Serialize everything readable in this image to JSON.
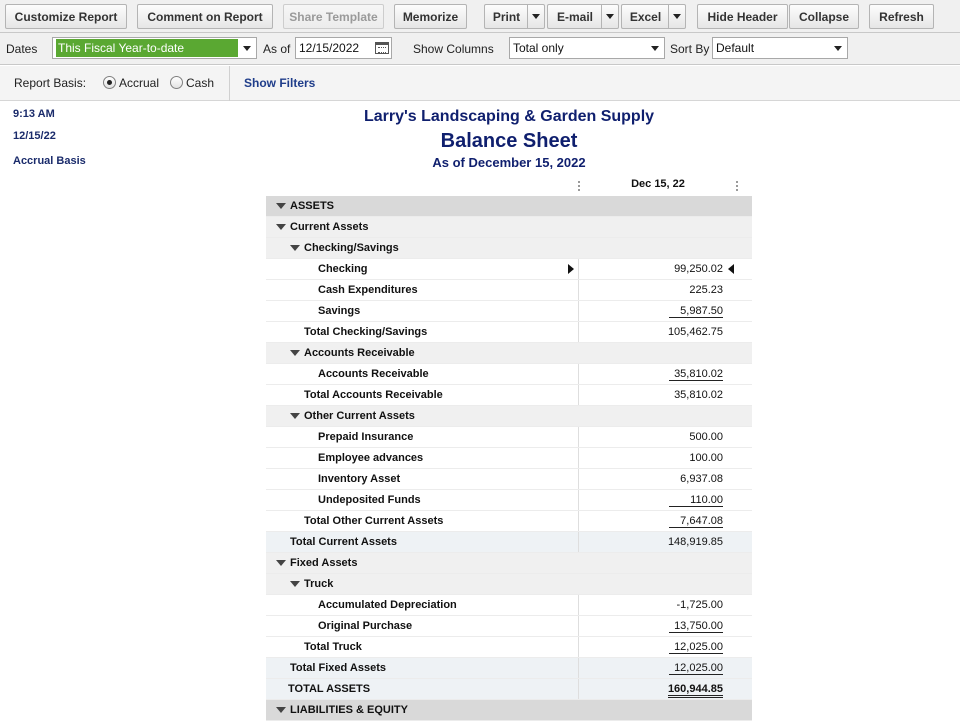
{
  "toolbar": {
    "customize": "Customize Report",
    "comment": "Comment on Report",
    "share": "Share Template",
    "memorize": "Memorize",
    "print": "Print",
    "email": "E-mail",
    "excel": "Excel",
    "hide_header": "Hide Header",
    "collapse": "Collapse",
    "refresh": "Refresh"
  },
  "filters": {
    "dates_label": "Dates",
    "dates_value": "This Fiscal Year-to-date",
    "as_of_label": "As of",
    "as_of_value": "12/15/2022",
    "show_columns_label": "Show Columns",
    "show_columns_value": "Total only",
    "sort_by_label": "Sort By",
    "sort_by_value": "Default"
  },
  "basis": {
    "label": "Report Basis:",
    "accrual": "Accrual",
    "cash": "Cash",
    "selected": "Accrual",
    "show_filters": "Show Filters"
  },
  "report": {
    "time": "9:13 AM",
    "date": "12/15/22",
    "basis_note": "Accrual Basis",
    "company": "Larry's Landscaping & Garden Supply",
    "title": "Balance Sheet",
    "subtitle": "As of December 15, 2022",
    "column_header": "Dec 15, 22",
    "rows": [
      {
        "label": "ASSETS",
        "amount": ""
      },
      {
        "label": "Current Assets",
        "amount": ""
      },
      {
        "label": "Checking/Savings",
        "amount": ""
      },
      {
        "label": "Checking",
        "amount": "99,250.02"
      },
      {
        "label": "Cash Expenditures",
        "amount": "225.23"
      },
      {
        "label": "Savings",
        "amount": "5,987.50"
      },
      {
        "label": "Total Checking/Savings",
        "amount": "105,462.75"
      },
      {
        "label": "Accounts Receivable",
        "amount": ""
      },
      {
        "label": "Accounts Receivable",
        "amount": "35,810.02"
      },
      {
        "label": "Total Accounts Receivable",
        "amount": "35,810.02"
      },
      {
        "label": "Other Current Assets",
        "amount": ""
      },
      {
        "label": "Prepaid Insurance",
        "amount": "500.00"
      },
      {
        "label": "Employee advances",
        "amount": "100.00"
      },
      {
        "label": "Inventory Asset",
        "amount": "6,937.08"
      },
      {
        "label": "Undeposited Funds",
        "amount": "110.00"
      },
      {
        "label": "Total Other Current Assets",
        "amount": "7,647.08"
      },
      {
        "label": "Total Current Assets",
        "amount": "148,919.85"
      },
      {
        "label": "Fixed Assets",
        "amount": ""
      },
      {
        "label": "Truck",
        "amount": ""
      },
      {
        "label": "Accumulated Depreciation",
        "amount": "-1,725.00"
      },
      {
        "label": "Original Purchase",
        "amount": "13,750.00"
      },
      {
        "label": "Total Truck",
        "amount": "12,025.00"
      },
      {
        "label": "Total Fixed Assets",
        "amount": "12,025.00"
      },
      {
        "label": "TOTAL ASSETS",
        "amount": "160,944.85"
      },
      {
        "label": "LIABILITIES & EQUITY",
        "amount": ""
      }
    ]
  }
}
